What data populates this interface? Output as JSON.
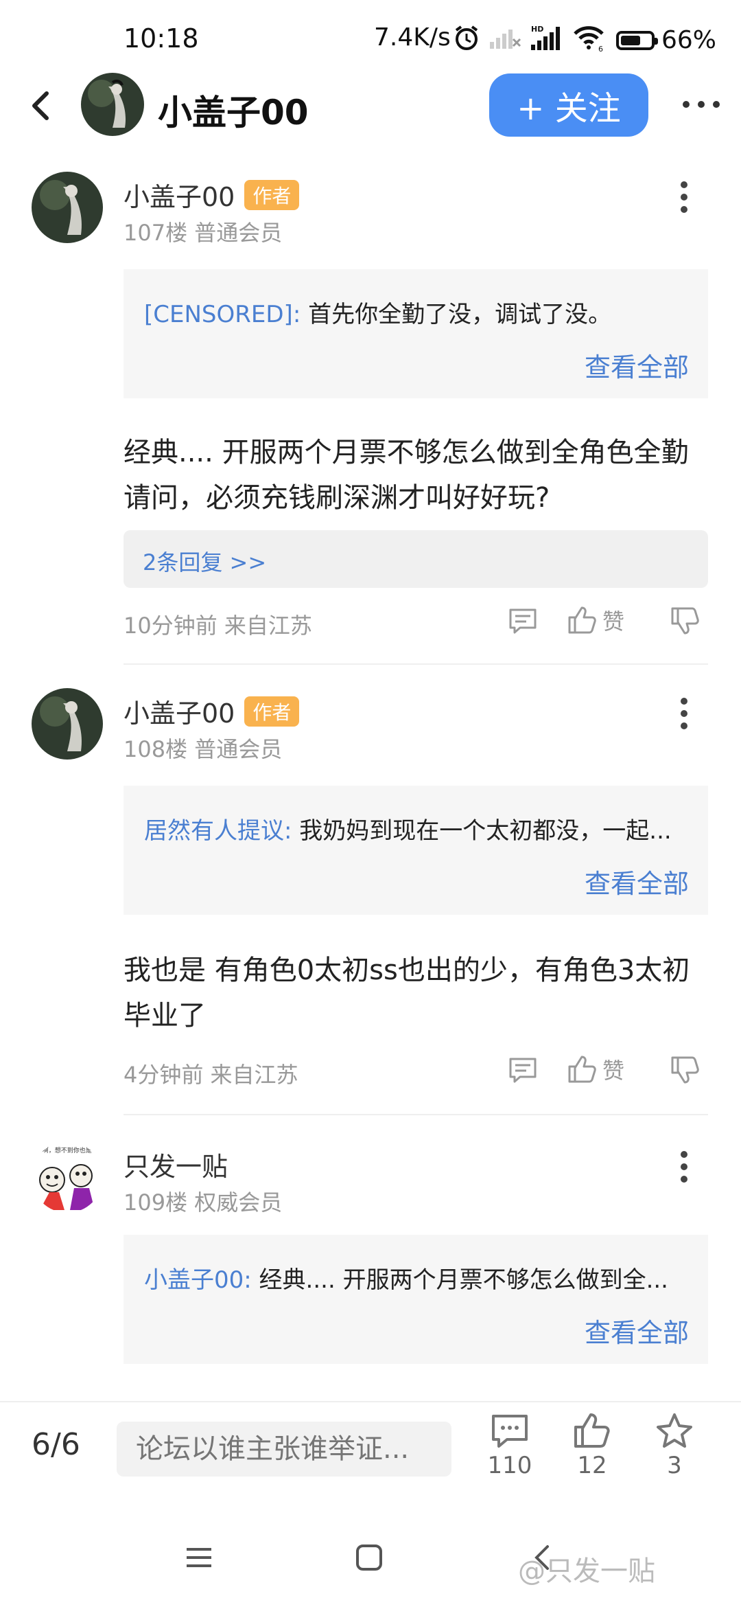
{
  "status_bar": {
    "time": "10:18",
    "net_speed": "7.4K/s",
    "battery_percent": "66%",
    "battery_level": 0.66
  },
  "header": {
    "title": "小盖子00",
    "follow_label": "+ 关注",
    "accent_color": "#4a8ef4"
  },
  "posts": [
    {
      "author": "小盖子00",
      "badge": "作者",
      "floor_info": "107楼 普通会员",
      "quote_user": "[CENSORED]:",
      "quote_text": " 首先你全勤了没，调试了没。",
      "quote_more": "查看全部",
      "body": "经典.... 开服两个月票不够怎么做到全角色全勤请问，必须充钱刷深渊才叫好好玩?",
      "replies": "2条回复 >>",
      "time": "10分钟前 来自江苏",
      "like_label": "赞"
    },
    {
      "author": "小盖子00",
      "badge": "作者",
      "floor_info": "108楼 普通会员",
      "quote_user": "居然有人提议:",
      "quote_text": " 我奶妈到现在一个太初都没，一起...",
      "quote_more": "查看全部",
      "body": "我也是 有角色0太初ss也出的少，有角色3太初毕业了",
      "time": "4分钟前 来自江苏",
      "like_label": "赞"
    },
    {
      "author": "只发一贴",
      "floor_info": "109楼 权威会员",
      "quote_user": "小盖子00:",
      "quote_text": " 经典.... 开服两个月票不够怎么做到全...",
      "quote_more": "查看全部"
    }
  ],
  "bottom_bar": {
    "page": "6/6",
    "input_placeholder": "论坛以谁主张谁举证...",
    "comment_count": "110",
    "like_count": "12",
    "star_count": "3"
  },
  "watermark": "@只发一贴",
  "icons": [
    "back-icon",
    "more-icon",
    "kebab-icon",
    "comment-icon",
    "thumb-up-icon",
    "thumb-down-icon",
    "star-icon",
    "menu-icon",
    "home-icon",
    "nav-back-icon",
    "alarm-icon",
    "signal-icon",
    "wifi-icon",
    "battery-icon"
  ]
}
